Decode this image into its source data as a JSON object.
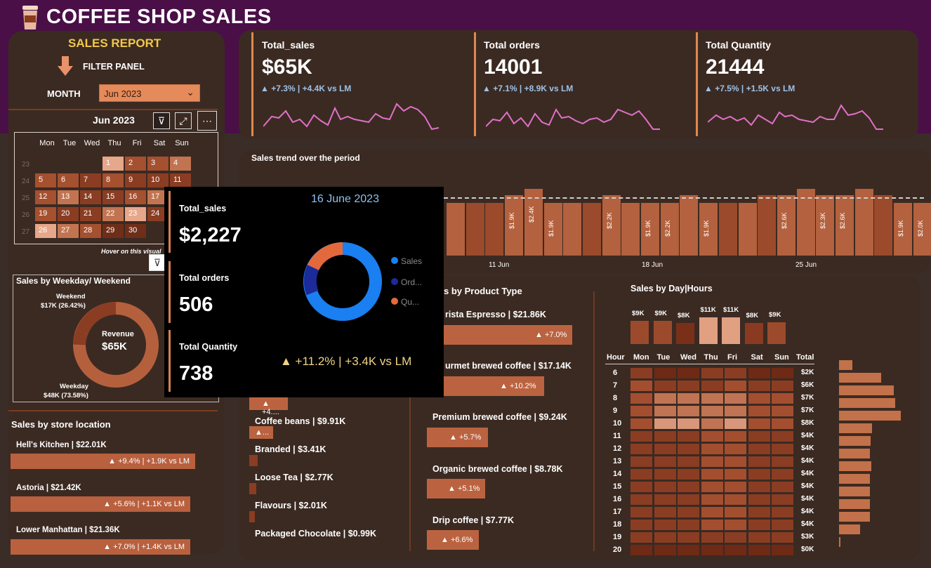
{
  "header": {
    "title": "COFFEE SHOP SALES",
    "cup_icon": "coffee-cup-icon"
  },
  "filter": {
    "title": "SALES REPORT",
    "panel_label": "FILTER PANEL",
    "month_label": "MONTH",
    "month_value": "Jun 2023"
  },
  "calendar": {
    "title": "Jun 2023",
    "days": [
      "Mon",
      "Tue",
      "Wed",
      "Thu",
      "Fri",
      "Sat",
      "Sun"
    ],
    "weeks": [
      "23",
      "24",
      "25",
      "26",
      "27"
    ],
    "hover_note": "Hover on this visual"
  },
  "kpis": [
    {
      "title": "Total_sales",
      "value": "$65K",
      "delta": "▲ +7.3% | +4.4K vs LM"
    },
    {
      "title": "Total orders",
      "value": "14001",
      "delta": "▲ +7.1% | +8.9K vs LM"
    },
    {
      "title": "Total Quantity",
      "value": "21444",
      "delta": "▲ +7.5% | +1.5K vs LM"
    }
  ],
  "trend": {
    "title": "Sales trend over the period",
    "x_ticks": [
      "11 Jun",
      "18 Jun",
      "25 Jun"
    ],
    "bar_labels": [
      "$1.9K",
      "$2.4K",
      "$1.9K",
      "$2.2K",
      "$1.9K",
      "$2.2K",
      "$1.9K",
      "$2.6K",
      "$2.3K",
      "$2.6K",
      "$1.9K",
      "$2.0K"
    ]
  },
  "weekday": {
    "title": "Sales by Weekday/ Weekend",
    "center_title": "Revenue",
    "center_value": "$65K",
    "weekend_label": "Weekend",
    "weekend_value": "$17K (26.42%)",
    "weekday_label": "Weekday",
    "weekday_value": "$48K (73.58%)"
  },
  "store": {
    "title": "Sales by store location",
    "items": [
      {
        "label": "Hell's Kitchen | $22.01K",
        "delta": "▲ +9.4% | +1.9K vs LM"
      },
      {
        "label": "Astoria | $21.42K",
        "delta": "▲ +5.6% | +1.1K vs LM"
      },
      {
        "label": "Lower Manhattan | $21.36K",
        "delta": "▲ +7.0% | +1.4K vs LM"
      }
    ]
  },
  "product": {
    "title": "s by Product Type",
    "left": [
      {
        "label": "Coffee beans | $9.91K",
        "delta": "▲..."
      },
      {
        "label": "Branded | $3.41K",
        "delta": ""
      },
      {
        "label": "Loose Tea | $2.77K",
        "delta": ""
      },
      {
        "label": "Flavours | $2.01K",
        "delta": ""
      },
      {
        "label": "Packaged Chocolate | $0.99K",
        "delta": ""
      }
    ],
    "left_top_delta": "▲ +4....",
    "right": [
      {
        "label": "rista Espresso | $21.86K",
        "delta": "▲ +7.0%"
      },
      {
        "label": "urmet brewed coffee | $17.14K",
        "delta": "▲ +10.2%"
      },
      {
        "label": "Premium brewed coffee | $9.24K",
        "delta": "▲ +5.7%"
      },
      {
        "label": "Organic brewed coffee | $8.78K",
        "delta": "▲ +5.1%"
      },
      {
        "label": "Drip coffee | $7.77K",
        "delta": "▲ +6.6%"
      }
    ]
  },
  "dayhours": {
    "title": "Sales by Day|Hours",
    "day_totals": [
      "$9K",
      "$9K",
      "$8K",
      "$11K",
      "$11K",
      "$8K",
      "$9K"
    ],
    "head_hour": "Hour",
    "days": [
      "Mon",
      "Tue",
      "Wed",
      "Thu",
      "Fri",
      "Sat",
      "Sun"
    ],
    "head_total": "Total",
    "hours": [
      "6",
      "7",
      "8",
      "9",
      "10",
      "11",
      "12",
      "13",
      "14",
      "15",
      "16",
      "17",
      "18",
      "19",
      "20"
    ],
    "hour_totals": [
      "$2K",
      "$6K",
      "$7K",
      "$7K",
      "$8K",
      "$4K",
      "$4K",
      "$4K",
      "$4K",
      "$4K",
      "$4K",
      "$4K",
      "$4K",
      "$3K",
      "$0K"
    ]
  },
  "popup": {
    "date": "16 June 2023",
    "sales_title": "Total_sales",
    "sales_value": "$2,227",
    "orders_title": "Total orders",
    "orders_value": "506",
    "qty_title": "Total Quantity",
    "qty_value": "738",
    "legend": [
      "Sales",
      "Ord...",
      "Qu..."
    ],
    "delta": "▲ +11.2% | +3.4K vs LM"
  },
  "colors": {
    "accent": "#e58a5a",
    "header": "#4a0f47",
    "panel": "#3b2a22",
    "delta_blue": "#9cc2ea"
  }
}
